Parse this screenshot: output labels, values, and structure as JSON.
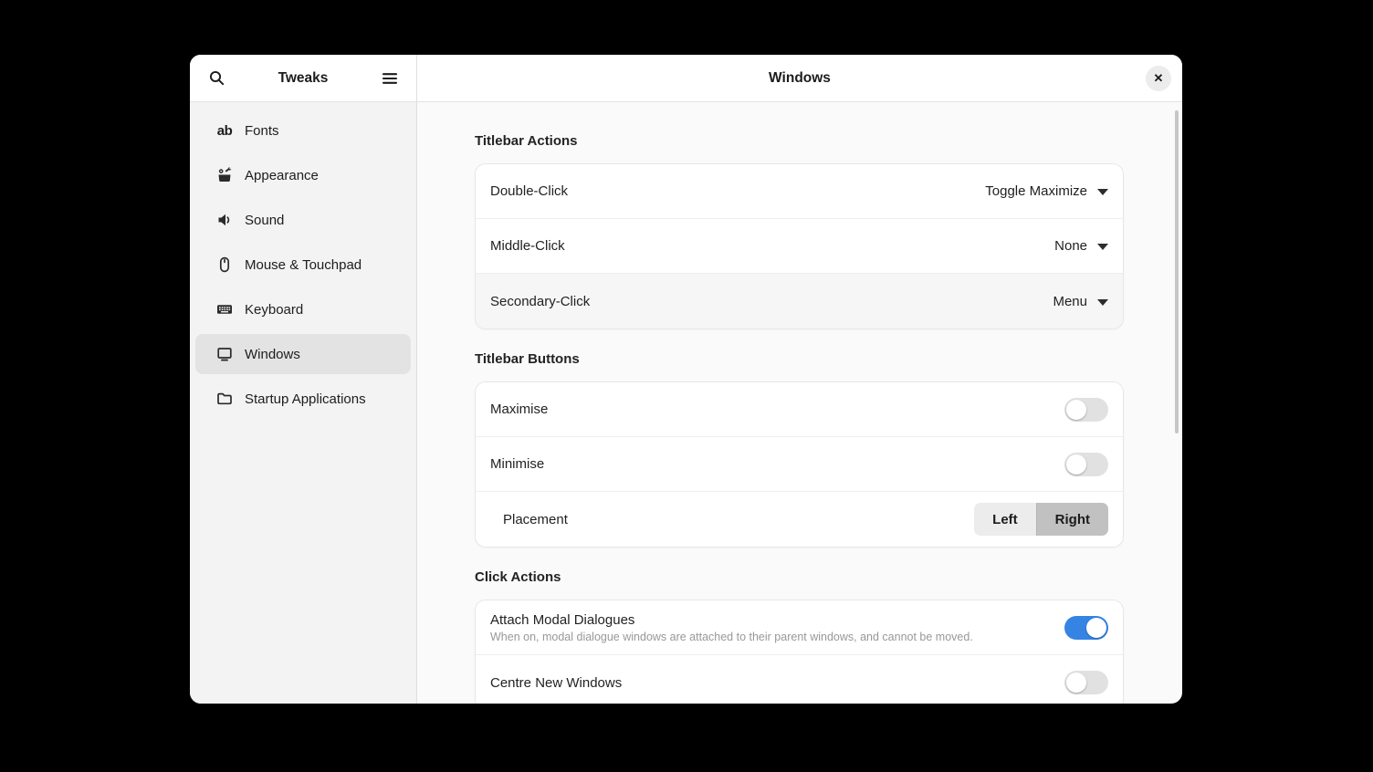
{
  "window": {
    "sidebar": {
      "title": "Tweaks",
      "items": [
        {
          "label": "Fonts",
          "icon": "fonts-icon",
          "selected": false
        },
        {
          "label": "Appearance",
          "icon": "appearance-icon",
          "selected": false
        },
        {
          "label": "Sound",
          "icon": "sound-icon",
          "selected": false
        },
        {
          "label": "Mouse & Touchpad",
          "icon": "mouse-icon",
          "selected": false
        },
        {
          "label": "Keyboard",
          "icon": "keyboard-icon",
          "selected": false
        },
        {
          "label": "Windows",
          "icon": "display-icon",
          "selected": true
        },
        {
          "label": "Startup Applications",
          "icon": "folder-icon",
          "selected": false
        }
      ],
      "fonts_glyph": "ab"
    },
    "header": {
      "title": "Windows",
      "close_glyph": "✕"
    },
    "sections": [
      {
        "heading": "Titlebar Actions",
        "rows": [
          {
            "type": "dropdown",
            "label": "Double-Click",
            "value": "Toggle Maximize"
          },
          {
            "type": "dropdown",
            "label": "Middle-Click",
            "value": "None"
          },
          {
            "type": "dropdown",
            "label": "Secondary-Click",
            "value": "Menu"
          }
        ]
      },
      {
        "heading": "Titlebar Buttons",
        "rows": [
          {
            "type": "toggle",
            "label": "Maximise",
            "on": false
          },
          {
            "type": "toggle",
            "label": "Minimise",
            "on": false
          },
          {
            "type": "segmented",
            "label": "Placement",
            "options": [
              "Left",
              "Right"
            ],
            "selected": "Right"
          }
        ]
      },
      {
        "heading": "Click Actions",
        "rows": [
          {
            "type": "toggle",
            "label": "Attach Modal Dialogues",
            "subtitle": "When on, modal dialogue windows are attached to their parent windows, and cannot be moved.",
            "on": true
          },
          {
            "type": "toggle",
            "label": "Centre New Windows",
            "on": false
          }
        ]
      }
    ],
    "colors": {
      "accent": "#3584e4",
      "toggle_off_track": "#e1e1e1",
      "selected_sidebar_bg": "#e3e3e3",
      "segment_active_bg": "#c1c1c1",
      "segment_bg": "#ececec",
      "card_bg": "#ffffff",
      "window_bg": "#fafafa"
    }
  }
}
